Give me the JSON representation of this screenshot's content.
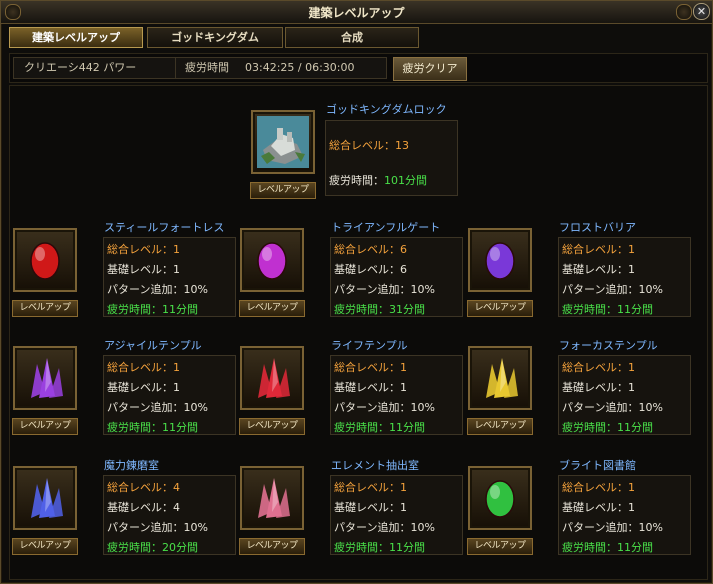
{
  "window": {
    "title": "建築レベルアップ"
  },
  "tabs": [
    "建築レベルアップ",
    "ゴッドキングダム",
    "合成"
  ],
  "info": {
    "power": "クリエーシ442 パワー",
    "fatigue_label": "疲労時間",
    "fatigue_value": "03:42:25 / 06:30:00",
    "clear_button": "疲労クリア"
  },
  "labels": {
    "total_level": "総合レベル：",
    "base_level": "基礎レベル：",
    "pattern": "パターン追加：",
    "fatigue": "疲労時間：",
    "level_up": "レベルアップ"
  },
  "top_building": {
    "name": "ゴッドキングダムロック",
    "total_level": "13",
    "fatigue": "101分間"
  },
  "buildings": [
    {
      "name": "スティールフォートレス",
      "total_level": "1",
      "base_level": "1",
      "pattern": "10%",
      "fatigue": "11分間",
      "gem_color": "#d01818"
    },
    {
      "name": "トライアンフルゲート",
      "total_level": "6",
      "base_level": "6",
      "pattern": "10%",
      "fatigue": "31分間",
      "gem_color": "#c030d0"
    },
    {
      "name": "フロストバリア",
      "total_level": "1",
      "base_level": "1",
      "pattern": "10%",
      "fatigue": "11分間",
      "gem_color": "#7a38d8"
    },
    {
      "name": "アジャイルテンプル",
      "total_level": "1",
      "base_level": "1",
      "pattern": "10%",
      "fatigue": "11分間",
      "gem_color": "#9a40e0"
    },
    {
      "name": "ライフテンプル",
      "total_level": "1",
      "base_level": "1",
      "pattern": "10%",
      "fatigue": "11分間",
      "gem_color": "#e02838"
    },
    {
      "name": "フォーカステンプル",
      "total_level": "1",
      "base_level": "1",
      "pattern": "10%",
      "fatigue": "11分間",
      "gem_color": "#e8c830"
    },
    {
      "name": "魔力錬磨室",
      "total_level": "4",
      "base_level": "4",
      "pattern": "10%",
      "fatigue": "20分間",
      "gem_color": "#5060e8"
    },
    {
      "name": "エレメント抽出室",
      "total_level": "1",
      "base_level": "1",
      "pattern": "10%",
      "fatigue": "11分間",
      "gem_color": "#e07090"
    },
    {
      "name": "ブライト図書館",
      "total_level": "1",
      "base_level": "1",
      "pattern": "10%",
      "fatigue": "11分間",
      "gem_color": "#30c040"
    }
  ]
}
